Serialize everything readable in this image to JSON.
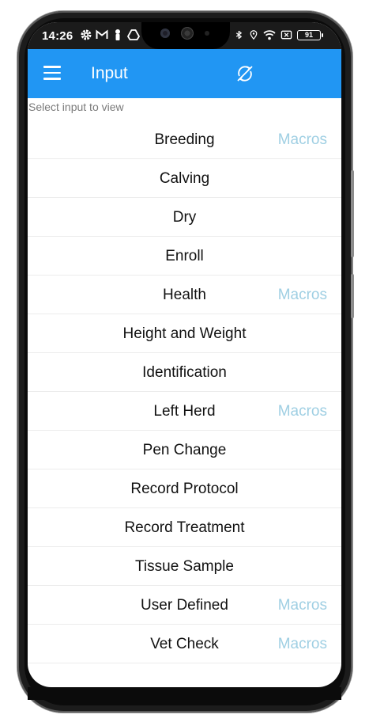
{
  "status_bar": {
    "time": "14:26",
    "battery": "91",
    "left_icons": [
      "gear-icon",
      "gmail-icon",
      "person-pin-icon",
      "drive-icon"
    ],
    "right_icons": [
      "bluetooth-icon",
      "location-icon",
      "wifi-icon",
      "no-sim-icon",
      "battery-icon"
    ]
  },
  "app_bar": {
    "title": "Input",
    "menu_icon": "hamburger-menu-icon",
    "sync_icon": "sync-disabled-icon",
    "color": "#2196F3"
  },
  "hint": "Select input to view",
  "items": [
    {
      "label": "Breeding",
      "macro": "Macros"
    },
    {
      "label": "Calving",
      "macro": ""
    },
    {
      "label": "Dry",
      "macro": ""
    },
    {
      "label": "Enroll",
      "macro": ""
    },
    {
      "label": "Health",
      "macro": "Macros"
    },
    {
      "label": "Height and Weight",
      "macro": ""
    },
    {
      "label": "Identification",
      "macro": ""
    },
    {
      "label": "Left Herd",
      "macro": "Macros"
    },
    {
      "label": "Pen Change",
      "macro": ""
    },
    {
      "label": "Record Protocol",
      "macro": ""
    },
    {
      "label": "Record Treatment",
      "macro": ""
    },
    {
      "label": "Tissue Sample",
      "macro": ""
    },
    {
      "label": "User Defined",
      "macro": "Macros"
    },
    {
      "label": "Vet Check",
      "macro": "Macros"
    }
  ],
  "colors": {
    "macro_text": "#9fcfe3",
    "item_text": "#111111",
    "hint_text": "#7a7a7a"
  }
}
